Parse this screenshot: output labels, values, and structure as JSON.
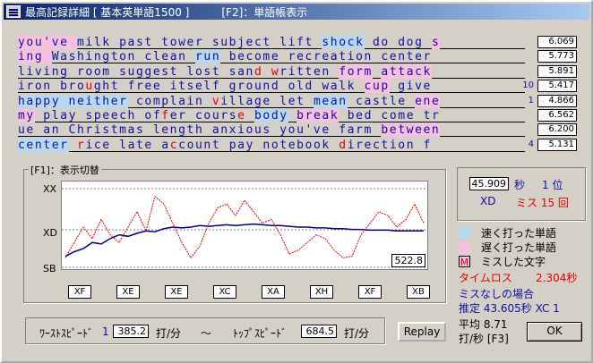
{
  "window": {
    "title": "最高記録詳細 [ 基本英単語1500 ]",
    "f2_label": "[F2]：単語帳表示"
  },
  "text_lines": [
    {
      "segments": [
        {
          "t": "you've ",
          "c": "slow"
        },
        {
          "t": "milk past tower subject lift "
        },
        {
          "t": "shock",
          "c": "fast"
        },
        {
          "t": " do dog "
        },
        {
          "t": "s",
          "c": "slow"
        }
      ],
      "speed": "6.069",
      "misses": ""
    },
    {
      "segments": [
        {
          "t": "ing ",
          "c": "slow"
        },
        {
          "t": "Washington clean "
        },
        {
          "t": "run",
          "c": "fast"
        },
        {
          "t": " become recreation center"
        }
      ],
      "speed": "5.773",
      "misses": ""
    },
    {
      "segments": [
        {
          "t": " living room suggest lost san"
        },
        {
          "t": "d",
          "c": "err"
        },
        {
          "t": " "
        },
        {
          "t": "w",
          "c": "err"
        },
        {
          "t": "ritten "
        },
        {
          "t": "form",
          "c": "slow"
        },
        {
          "t": " "
        },
        {
          "t": "attack",
          "c": "slow"
        }
      ],
      "speed": "5.891",
      "misses": ""
    },
    {
      "segments": [
        {
          "t": "iron bro"
        },
        {
          "t": "u",
          "c": "err"
        },
        {
          "t": "ght free itself ground old walk "
        },
        {
          "t": "cup",
          "c": "slow"
        },
        {
          "t": " give "
        }
      ],
      "speed": "5.417",
      "misses": "10"
    },
    {
      "segments": [
        {
          "t": "happy neither",
          "c": "fast"
        },
        {
          "t": " complain "
        },
        {
          "t": "v",
          "c": "err"
        },
        {
          "t": "illage let "
        },
        {
          "t": "mean",
          "c": "fast"
        },
        {
          "t": " castle "
        },
        {
          "t": "ene",
          "c": "slow"
        }
      ],
      "speed": "4.866",
      "misses": "1"
    },
    {
      "segments": [
        {
          "t": "my",
          "c": "slow"
        },
        {
          "t": " play speech of"
        },
        {
          "t": "f",
          "c": "err"
        },
        {
          "t": "er cours"
        },
        {
          "t": "e",
          "c": "err"
        },
        {
          "t": " "
        },
        {
          "t": "body",
          "c": "fast"
        },
        {
          "t": " "
        },
        {
          "t": "break",
          "c": "slow"
        },
        {
          "t": " bed come tr"
        }
      ],
      "speed": "6.562",
      "misses": ""
    },
    {
      "segments": [
        {
          "t": "ue an Christmas length anxious you've farm "
        },
        {
          "t": "between",
          "c": "slow"
        }
      ],
      "speed": "6.200",
      "misses": ""
    },
    {
      "segments": [
        {
          "t": "  "
        },
        {
          "t": "center",
          "c": "fast"
        },
        {
          "t": " "
        },
        {
          "t": "r",
          "c": "err"
        },
        {
          "t": "ice late a"
        },
        {
          "t": "c",
          "c": "err"
        },
        {
          "t": "count pay notebook "
        },
        {
          "t": "d",
          "c": "err"
        },
        {
          "t": "irection f"
        }
      ],
      "speed": "5.131",
      "misses": "4"
    }
  ],
  "chart_panel": {
    "label": "[F1]：表示切替",
    "axis_top": "XX",
    "axis_mid": "XD",
    "axis_bot": "SB",
    "value_box": "522.8",
    "bottom_keys": [
      "XF",
      "XE",
      "XE",
      "XC",
      "XA",
      "XH",
      "XF",
      "XB"
    ]
  },
  "chart_data": {
    "type": "line",
    "series": [
      {
        "values": [
          0.12,
          0.18,
          0.22,
          0.3,
          0.28,
          0.35,
          0.4,
          0.38,
          0.42,
          0.45,
          0.44,
          0.48,
          0.5,
          0.49,
          0.5,
          0.52,
          0.51,
          0.52,
          0.53,
          0.52,
          0.53,
          0.54,
          0.53,
          0.52,
          0.52,
          0.51,
          0.5,
          0.5,
          0.49,
          0.49,
          0.48,
          0.48,
          0.47,
          0.47,
          0.46,
          0.46,
          0.46,
          0.45,
          0.45,
          0.45,
          0.45
        ],
        "color": "#000080"
      },
      {
        "values": [
          0.1,
          0.3,
          0.5,
          0.35,
          0.6,
          0.4,
          0.3,
          0.5,
          0.7,
          0.45,
          0.9,
          0.8,
          0.55,
          0.3,
          0.1,
          0.25,
          0.55,
          0.75,
          0.8,
          0.65,
          0.85,
          0.7,
          0.55,
          0.6,
          0.4,
          0.15,
          0.2,
          0.3,
          0.4,
          0.35,
          0.2,
          0.1,
          0.12,
          0.4,
          0.55,
          0.7,
          0.65,
          0.5,
          0.6,
          0.8,
          0.55
        ],
        "color": "#e00000"
      }
    ]
  },
  "result": {
    "time_value": "45.909",
    "time_unit": "秒",
    "rank": "1 位",
    "level": "XD",
    "misses": "ミス 15 回"
  },
  "legend": {
    "fast": "速く打った単語",
    "slow": "遅く打った単語",
    "miss_marker": "M",
    "miss": "ミスした文字"
  },
  "stats": {
    "time_loss_label": "タイムロス",
    "time_loss_value": "2.304秒",
    "no_miss_label": "ミスなしの場合",
    "estimate": "推定  43.605秒 XC  1",
    "avg_label": "平均  8.71",
    "avg_unit": "打/秒 [F3]"
  },
  "speed_range": {
    "worst_label": "ﾜｰｽﾄｽﾋﾟｰﾄﾞ",
    "worst_rank": "1",
    "worst_value": "385.2",
    "worst_unit": "打/分",
    "tilde": "〜",
    "top_label": "ﾄｯﾌﾟｽﾋﾟｰﾄﾞ",
    "top_value": "684.5",
    "top_unit": "打/分"
  },
  "buttons": {
    "replay": "Replay",
    "ok": "OK"
  },
  "colors": {
    "fast": "#b8d8f0",
    "slow": "#f8c0e0",
    "error": "#e00000",
    "text": "#1010a0"
  }
}
